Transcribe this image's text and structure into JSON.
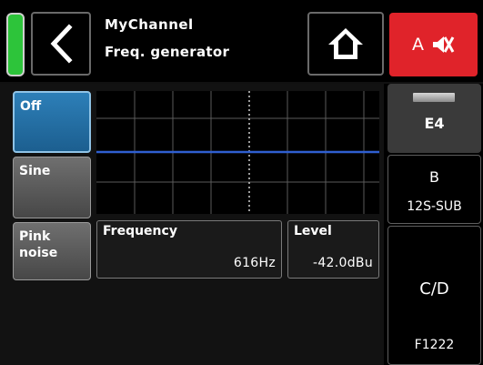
{
  "header": {
    "title": "MyChannel",
    "subtitle": "Freq. generator",
    "back_icon": "chevron-left-icon",
    "home_icon": "home-icon",
    "mute_label": "A",
    "mute_icon": "speaker-muted-icon",
    "colors": {
      "level_indicator": "#2dc43a",
      "mute_active": "#e0232a"
    }
  },
  "modes": {
    "off": "Off",
    "sine": "Sine",
    "pink_noise": "Pink noise",
    "selected": "Off",
    "colors": {
      "selected": "#1f6fa6",
      "unselected": "#5a5a5a"
    }
  },
  "frequency": {
    "label": "Frequency",
    "value": "616Hz"
  },
  "level": {
    "label": "Level",
    "value": "-42.0dBu"
  },
  "tabs": {
    "e4": {
      "label": "E4"
    },
    "b": {
      "label": "B",
      "sub": "12S-SUB"
    },
    "cd": {
      "label": "C/D",
      "sub": "F1222"
    }
  }
}
